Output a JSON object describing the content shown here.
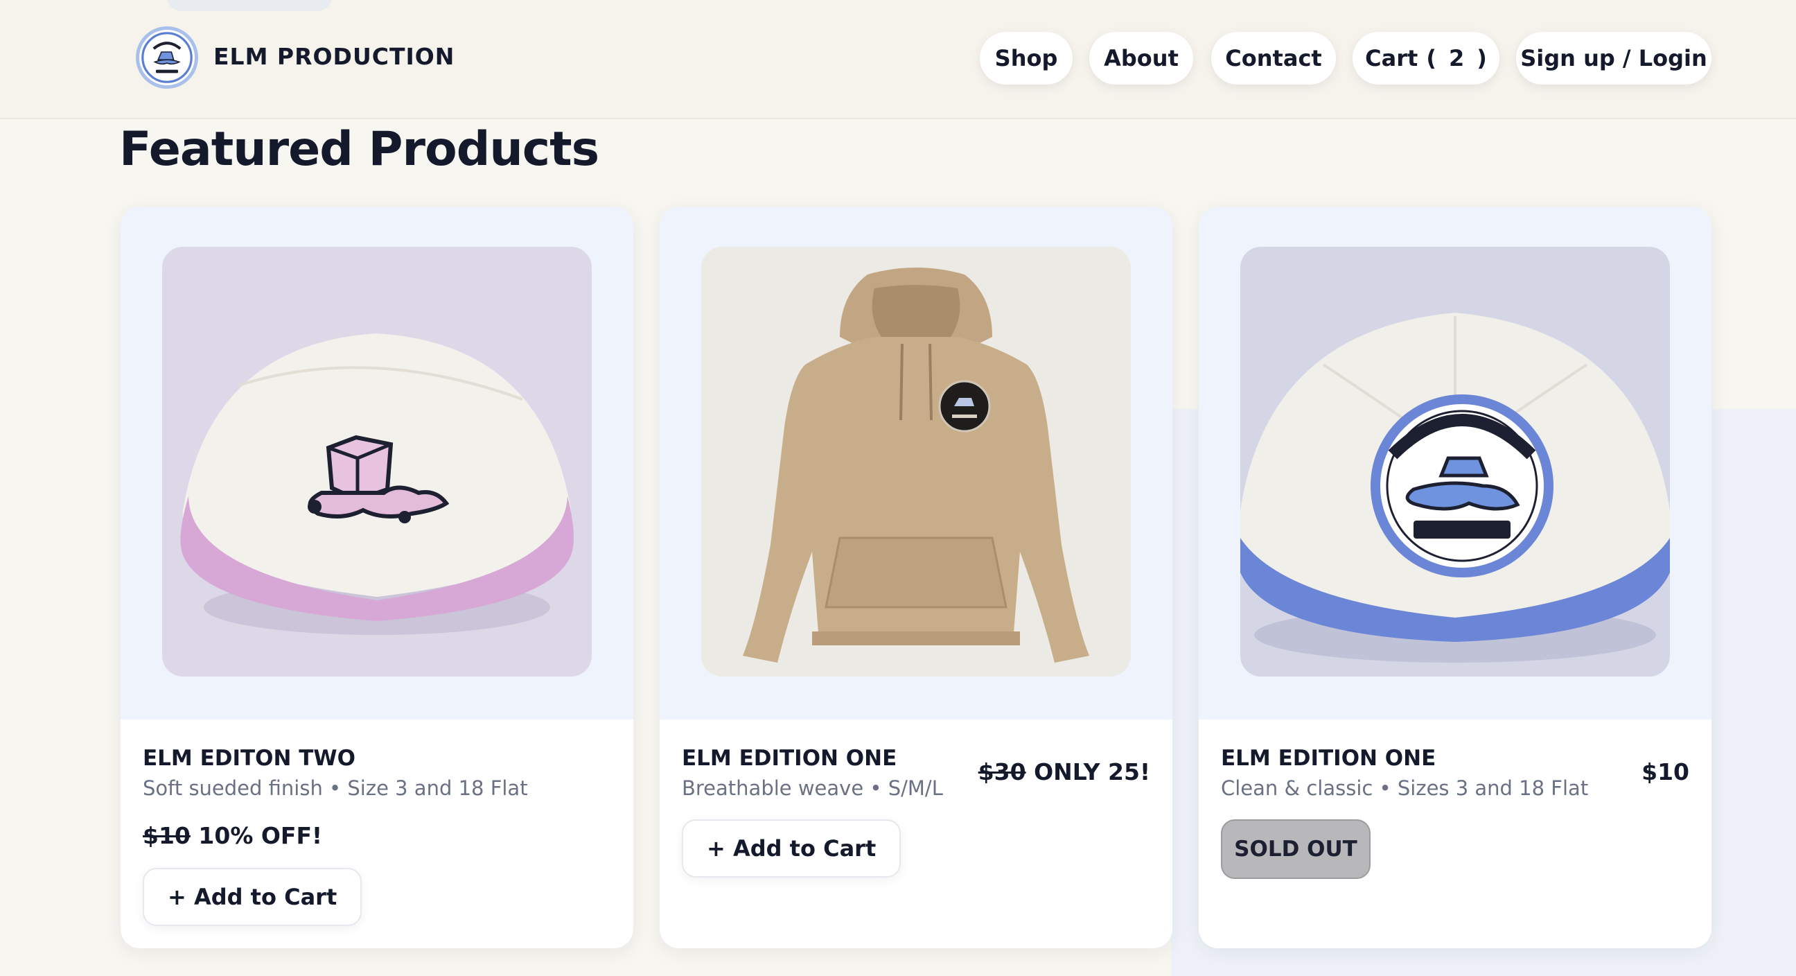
{
  "header": {
    "brand": "ELM PRODUCTION",
    "nav": {
      "shop": "Shop",
      "about": "About",
      "contact": "Contact",
      "cart_label": "Cart",
      "cart_open": "(",
      "cart_count": "2",
      "cart_close": ")",
      "signin": "Sign up / Login"
    }
  },
  "main": {
    "title": "Featured Products",
    "products": [
      {
        "name": "ELM EDITON TWO",
        "description": "Soft sueded finish • Size 3 and 18 Flat",
        "price_old": "$10",
        "price_note": "10% OFF!",
        "button": "+ Add to Cart",
        "image": "kippah-pink-melting-ice-cube"
      },
      {
        "name": "ELM EDITION ONE",
        "description": "Breathable weave • S/M/L",
        "price_old": "$30",
        "price_note": "ONLY 25!",
        "button": "+ Add to Cart",
        "image": "tan-hoodie-with-badge"
      },
      {
        "name": "ELM EDITION ONE",
        "description": "Clean & classic • Sizes 3 and 18 Flat",
        "price": "$10",
        "button": "SOLD OUT",
        "image": "kippah-blue-elm-production-patch"
      }
    ]
  },
  "colors": {
    "background": "#f8f6f1",
    "text": "#141a2c",
    "muted": "#6a7184",
    "card_media": "#eff4fc",
    "sold_out": "#b8b8bb",
    "pink_trim": "#d7a8d6",
    "blue_trim": "#6b86d6",
    "hoodie": "#c8ad8a"
  }
}
